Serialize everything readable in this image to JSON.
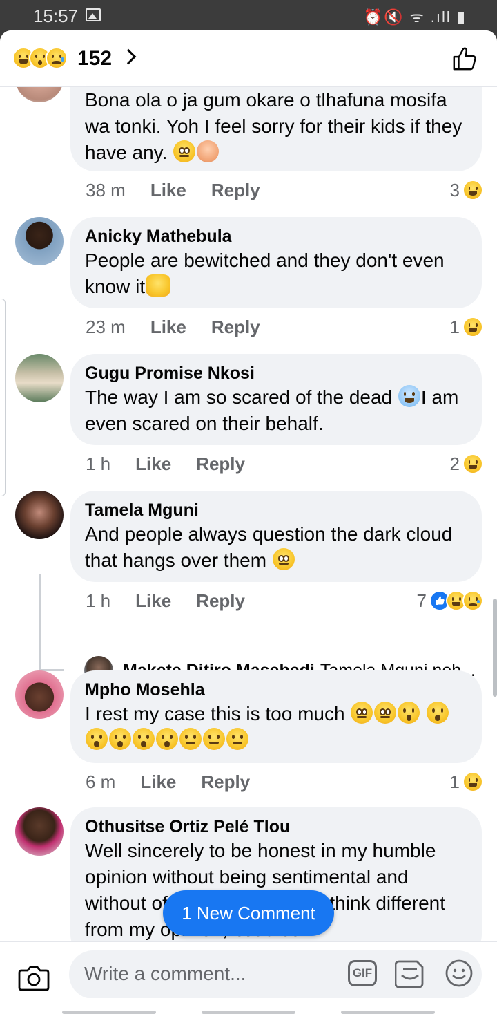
{
  "status_bar": {
    "time": "15:57",
    "icons": "⏰🔇 ᯤ .ıll ▮"
  },
  "header": {
    "reaction_count": "152"
  },
  "comments": [
    {
      "author": "",
      "text": "Bona ola o ja gum okare o tlhafuna mosifa wa tonki.  Yoh I feel sorry for their kids if they have any.",
      "time": "38 m",
      "like": "Like",
      "reply": "Reply",
      "reactions": "3"
    },
    {
      "author": "Anicky Mathebula",
      "text": "People are bewitched and they don't even know it",
      "time": "23 m",
      "like": "Like",
      "reply": "Reply",
      "reactions": "1"
    },
    {
      "author": "Gugu Promise Nkosi",
      "text_a": "The way I am so scared of the dead",
      "text_b": "I am even scared on their behalf.",
      "time": "1 h",
      "like": "Like",
      "reply": "Reply",
      "reactions": "2"
    },
    {
      "author": "Tamela Mguni",
      "text": "And people always question the dark cloud that hangs over them",
      "time": "1 h",
      "like": "Like",
      "reply": "Reply",
      "reactions": "7",
      "reply_preview": {
        "author": "Makete Ditiro Masebedi",
        "text": "Tamela Mguni neh..."
      }
    },
    {
      "author": "Mpho Mosehla",
      "text": "I rest my case this is too much",
      "time": "6 m",
      "like": "Like",
      "reply": "Reply",
      "reactions": "1"
    },
    {
      "author": "Othusitse Ortiz Pelé Tlou",
      "text": "Well sincerely to be honest in my humble opinion without being sentimental and without offending those who think different from my opinion, but also"
    }
  ],
  "new_comment_pill": "1 New Comment",
  "composer": {
    "placeholder": "Write a comment...",
    "gif_label": "GIF"
  }
}
